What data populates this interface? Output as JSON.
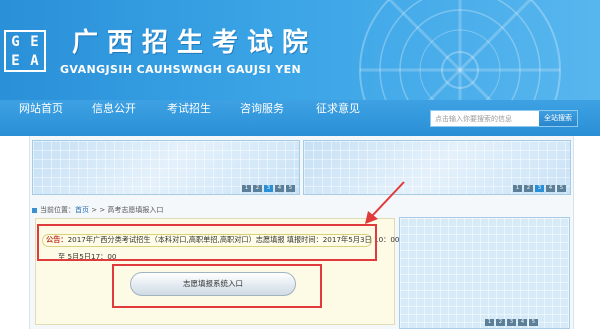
{
  "header": {
    "logo_letters": [
      "G",
      "E",
      "E",
      "A"
    ],
    "title": "广西招生考试院",
    "subtitle": "GVANGJSIH CAUHSWNGH GAUJSI YEN"
  },
  "nav": {
    "items": [
      "网站首页",
      "信息公开",
      "考试招生",
      "咨询服务",
      "征求意见"
    ],
    "search": {
      "placeholder": "点击输入你要搜索的信息",
      "button_label": "全站搜索"
    }
  },
  "banners": {
    "pager_left": [
      "1",
      "2",
      "3",
      "4",
      "5"
    ],
    "pager_right": [
      "1",
      "2",
      "3",
      "4",
      "5"
    ],
    "active_index": 3
  },
  "breadcrumb": {
    "label": "当前位置：",
    "home": "首页",
    "sep": " > > ",
    "current": "高考志愿填报入口"
  },
  "notice": {
    "tag": "公告：",
    "line1": "2017年广西分类考试招生（本科对口,高职单招,高职对口）志愿填报 填报时间：2017年5月3日 10：00",
    "line2": "至 5月5日17：00"
  },
  "entry_button": {
    "label": "志愿填报系统入口"
  },
  "side_pager": [
    "1",
    "2",
    "3",
    "4",
    "5"
  ],
  "colors": {
    "brand_blue": "#2b8fd6",
    "highlight_red": "#e03a3a",
    "notice_bg": "#fdfbe6"
  }
}
